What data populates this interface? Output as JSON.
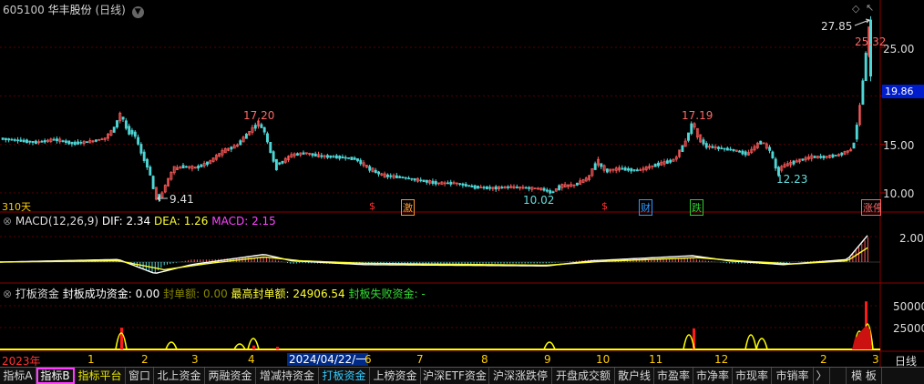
{
  "header": {
    "stock_code": "605100",
    "stock_name": "华丰股份",
    "period": "(日线)",
    "dropdown_icon": "chevron-down-icon"
  },
  "price_panel": {
    "y_ticks": [
      "25.00",
      "15.00",
      "10.00"
    ],
    "current_price": "19.86",
    "high_label": "27.85",
    "last_close_label": "25.32",
    "annotations": {
      "peak1": "17.20",
      "peak2": "17.19",
      "low1": "9.41",
      "low2": "10.02",
      "low3": "12.23"
    },
    "days_label": "310天",
    "event_markers": [
      {
        "text": "$",
        "color": "#ff3333"
      },
      {
        "text": "激",
        "color": "#ff9933"
      },
      {
        "text": "$",
        "color": "#ff3333"
      },
      {
        "text": "财",
        "color": "#3399ff"
      },
      {
        "text": "跌",
        "color": "#33cc33"
      },
      {
        "text": "涨停",
        "color": "#ff6666"
      }
    ]
  },
  "macd_panel": {
    "title": "MACD(12,26,9)",
    "dif_label": "DIF: 2.34",
    "dea_label": "DEA: 1.26",
    "macd_label": "MACD: 2.15",
    "y_tick": "2.00"
  },
  "daban_panel": {
    "title": "打板资金",
    "success_label": "封板成功资金: 0.00",
    "seal_label": "封单额: 0.00",
    "max_seal_label": "最高封单额: 24906.54",
    "fail_label": "封板失败资金: -",
    "y_ticks": [
      "50000",
      "25000"
    ]
  },
  "time_axis": {
    "year_label": "2023年",
    "months": [
      "1",
      "2",
      "3",
      "4",
      "6",
      "7",
      "8",
      "9",
      "10",
      "11",
      "12",
      "2",
      "3"
    ],
    "cursor_date": "2024/04/22/一",
    "right_label": "日线"
  },
  "tabs": [
    {
      "label": "指标A",
      "style": "normal"
    },
    {
      "label": "指标B",
      "style": "active"
    },
    {
      "label": "指标平台",
      "style": "yellow"
    },
    {
      "label": "窗口",
      "style": "normal"
    },
    {
      "label": "北上资金",
      "style": "normal"
    },
    {
      "label": "两融资金",
      "style": "normal"
    },
    {
      "label": "增减持资金",
      "style": "normal"
    },
    {
      "label": "打板资金",
      "style": "cyan"
    },
    {
      "label": "上榜资金",
      "style": "normal"
    },
    {
      "label": "沪深ETF资金",
      "style": "normal"
    },
    {
      "label": "沪深涨跌停",
      "style": "normal"
    },
    {
      "label": "开盘成交额",
      "style": "normal"
    },
    {
      "label": "散户线",
      "style": "normal"
    },
    {
      "label": "市盈率",
      "style": "normal"
    },
    {
      "label": "市净率",
      "style": "normal"
    },
    {
      "label": "市现率",
      "style": "normal"
    },
    {
      "label": "市销率",
      "style": "normal"
    },
    {
      "label": "〉",
      "style": "normal"
    },
    {
      "label": "模 板",
      "style": "normal"
    }
  ],
  "chart_data": {
    "type": "candlestick",
    "title": "605100 华丰股份 (日线)",
    "ylim": [
      9,
      29
    ],
    "price_path": [
      [
        0,
        15.6
      ],
      [
        20,
        15.4
      ],
      [
        40,
        15.2
      ],
      [
        60,
        15.5
      ],
      [
        80,
        15.1
      ],
      [
        100,
        15.3
      ],
      [
        115,
        15.6
      ],
      [
        125,
        16.6
      ],
      [
        132,
        18.1
      ],
      [
        140,
        16.5
      ],
      [
        148,
        16.0
      ],
      [
        156,
        14.0
      ],
      [
        163,
        12.5
      ],
      [
        170,
        10.0
      ],
      [
        175,
        9.41
      ],
      [
        182,
        10.8
      ],
      [
        190,
        12.4
      ],
      [
        200,
        12.7
      ],
      [
        215,
        12.6
      ],
      [
        230,
        13.2
      ],
      [
        245,
        14.3
      ],
      [
        260,
        14.9
      ],
      [
        275,
        16.4
      ],
      [
        283,
        17.2
      ],
      [
        290,
        16.4
      ],
      [
        296,
        14.6
      ],
      [
        302,
        12.9
      ],
      [
        310,
        13.2
      ],
      [
        320,
        13.9
      ],
      [
        335,
        14.1
      ],
      [
        350,
        13.8
      ],
      [
        370,
        13.7
      ],
      [
        390,
        13.5
      ],
      [
        405,
        12.5
      ],
      [
        420,
        11.8
      ],
      [
        440,
        11.6
      ],
      [
        460,
        11.3
      ],
      [
        480,
        11.0
      ],
      [
        500,
        11.0
      ],
      [
        520,
        10.6
      ],
      [
        540,
        10.5
      ],
      [
        560,
        10.6
      ],
      [
        580,
        10.5
      ],
      [
        595,
        10.4
      ],
      [
        605,
        10.02
      ],
      [
        615,
        10.7
      ],
      [
        630,
        10.8
      ],
      [
        645,
        11.5
      ],
      [
        655,
        13.2
      ],
      [
        665,
        12.3
      ],
      [
        680,
        12.5
      ],
      [
        700,
        12.3
      ],
      [
        720,
        12.9
      ],
      [
        740,
        13.4
      ],
      [
        752,
        15.2
      ],
      [
        760,
        17.19
      ],
      [
        766,
        15.8
      ],
      [
        775,
        14.8
      ],
      [
        790,
        14.6
      ],
      [
        805,
        14.4
      ],
      [
        820,
        14.0
      ],
      [
        835,
        15.3
      ],
      [
        845,
        14.4
      ],
      [
        853,
        12.23
      ],
      [
        860,
        12.8
      ],
      [
        875,
        13.3
      ],
      [
        890,
        13.7
      ],
      [
        905,
        13.7
      ],
      [
        920,
        13.9
      ],
      [
        935,
        14.5
      ],
      [
        940,
        16.6
      ],
      [
        944,
        18.9
      ],
      [
        948,
        22.1
      ],
      [
        952,
        25.32
      ],
      [
        955,
        27.85
      ]
    ],
    "macd_series": {
      "dif": [
        [
          0,
          0
        ],
        [
          130,
          0.2
        ],
        [
          170,
          -0.9
        ],
        [
          210,
          -0.2
        ],
        [
          290,
          0.6
        ],
        [
          320,
          0.1
        ],
        [
          400,
          -0.2
        ],
        [
          600,
          -0.3
        ],
        [
          650,
          0.1
        ],
        [
          760,
          0.5
        ],
        [
          800,
          0.1
        ],
        [
          860,
          -0.2
        ],
        [
          930,
          0.2
        ],
        [
          955,
          2.34
        ]
      ],
      "dea": [
        [
          0,
          0
        ],
        [
          130,
          0.1
        ],
        [
          180,
          -0.6
        ],
        [
          230,
          -0.1
        ],
        [
          290,
          0.4
        ],
        [
          330,
          0.1
        ],
        [
          400,
          -0.1
        ],
        [
          600,
          -0.25
        ],
        [
          660,
          0.05
        ],
        [
          765,
          0.35
        ],
        [
          810,
          0.1
        ],
        [
          870,
          -0.15
        ],
        [
          930,
          0.1
        ],
        [
          955,
          1.26
        ]
      ]
    },
    "daban_spikes": [
      {
        "x": 133,
        "value": 24906.54
      },
      {
        "x": 278,
        "value": 4500
      },
      {
        "x": 304,
        "value": 3000
      },
      {
        "x": 761,
        "value": 24000
      },
      {
        "x": 950,
        "value": 55000
      }
    ]
  }
}
